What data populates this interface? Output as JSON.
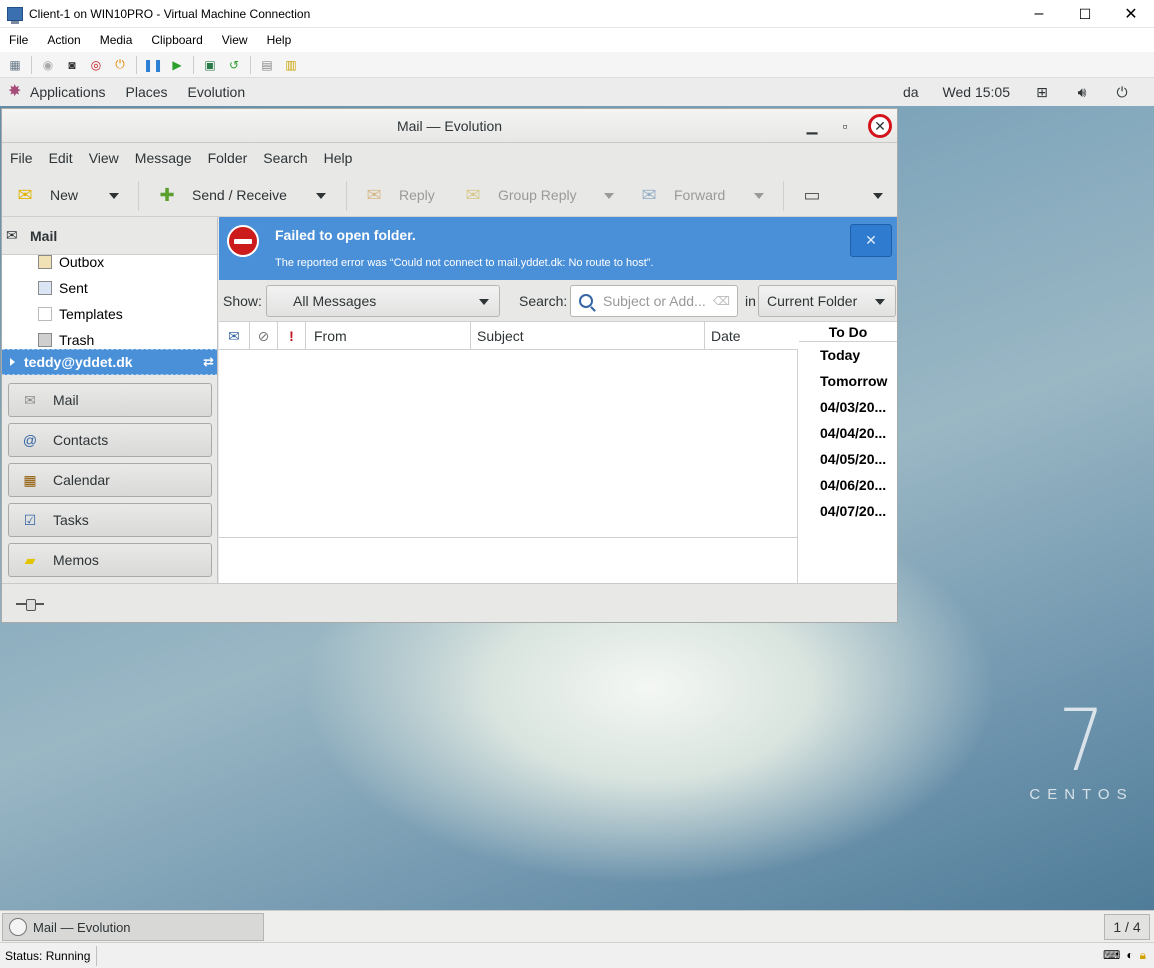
{
  "host": {
    "title": "Client-1 on WIN10PRO - Virtual Machine Connection",
    "controls": {
      "minimize": "–",
      "maximize": "☐",
      "close": "✕"
    },
    "menu": [
      "File",
      "Action",
      "Media",
      "Clipboard",
      "View",
      "Help"
    ],
    "status": "Status: Running"
  },
  "gnome": {
    "menus": [
      "Applications",
      "Places",
      "Evolution"
    ],
    "keyboard": "da",
    "clock": "Wed 15:05"
  },
  "desktop": {
    "logo_number": "7",
    "logo_word": "CENTOS"
  },
  "evolution": {
    "title": "Mail — Evolution",
    "menu": [
      "File",
      "Edit",
      "View",
      "Message",
      "Folder",
      "Search",
      "Help"
    ],
    "toolbar": {
      "new": "New",
      "send_receive": "Send / Receive",
      "reply": "Reply",
      "group_reply": "Group Reply",
      "forward": "Forward"
    },
    "sidebar": {
      "header": "Mail",
      "folders": [
        "Outbox",
        "Sent",
        "Templates",
        "Trash"
      ],
      "account": "teddy@yddet.dk",
      "switcher": [
        "Mail",
        "Contacts",
        "Calendar",
        "Tasks",
        "Memos"
      ]
    },
    "infobar": {
      "heading": "Failed to open folder.",
      "detail": "The reported error was “Could not connect to mail.yddet.dk: No route to host”.",
      "close": "✕"
    },
    "filter": {
      "show_label": "Show:",
      "show_value": "All Messages",
      "search_label": "Search:",
      "search_placeholder": "Subject or Add...",
      "in_label": "in",
      "scope_value": "Current Folder"
    },
    "columns": [
      "From",
      "Subject",
      "Date"
    ],
    "todo": {
      "header": "To Do",
      "days": [
        "Today",
        "Tomorrow",
        "04/03/20...",
        "04/04/20...",
        "04/05/20...",
        "04/06/20...",
        "04/07/20..."
      ]
    }
  },
  "taskbar": {
    "window": "Mail — Evolution",
    "workspace": "1 / 4"
  },
  "colors": {
    "selection": "#4a90d9",
    "error": "#cc1b1b",
    "close_ring": "#d4141c"
  }
}
